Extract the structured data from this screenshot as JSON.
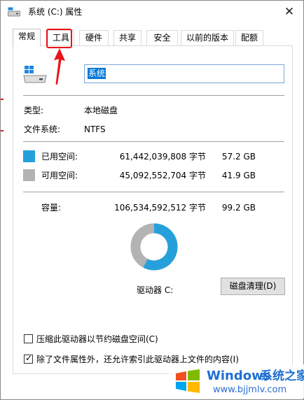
{
  "window": {
    "title": "系统 (C:) 属性",
    "close_glyph": "✕"
  },
  "tabs": [
    {
      "label": "常规",
      "active": true
    },
    {
      "label": "工具",
      "active": false
    },
    {
      "label": "硬件",
      "active": false
    },
    {
      "label": "共享",
      "active": false
    },
    {
      "label": "安全",
      "active": false
    },
    {
      "label": "以前的版本",
      "active": false
    },
    {
      "label": "配额",
      "active": false
    }
  ],
  "drive": {
    "name_value": "系统",
    "icon": "windows-drive-icon"
  },
  "info": {
    "type_label": "类型:",
    "type_value": "本地磁盘",
    "fs_label": "文件系统:",
    "fs_value": "NTFS"
  },
  "space": {
    "used_label": "已用空间:",
    "used_bytes": "61,442,039,808 字节",
    "used_size": "57.2 GB",
    "free_label": "可用空间:",
    "free_bytes": "45,092,552,704 字节",
    "free_size": "41.9 GB",
    "capacity_label": "容量:",
    "capacity_bytes": "106,534,592,512 字节",
    "capacity_size": "99.2 GB",
    "used_fraction": 0.577,
    "used_color": "#26a0da",
    "free_color": "#b3b3b3"
  },
  "drive_label": "驱动器 C:",
  "cleanup_button": "磁盘清理(D)",
  "options": [
    {
      "label": "压缩此驱动器以节约磁盘空间(C)",
      "checked": false
    },
    {
      "label": "除了文件属性外，还允许索引此驱动器上文件的内容(I)",
      "checked": true
    }
  ],
  "annotation": {
    "color": "#e8141a",
    "target": "工具"
  },
  "watermark": {
    "brand": "Windows",
    "cn": "系统之家",
    "url": "www.bjjmlv.com"
  }
}
